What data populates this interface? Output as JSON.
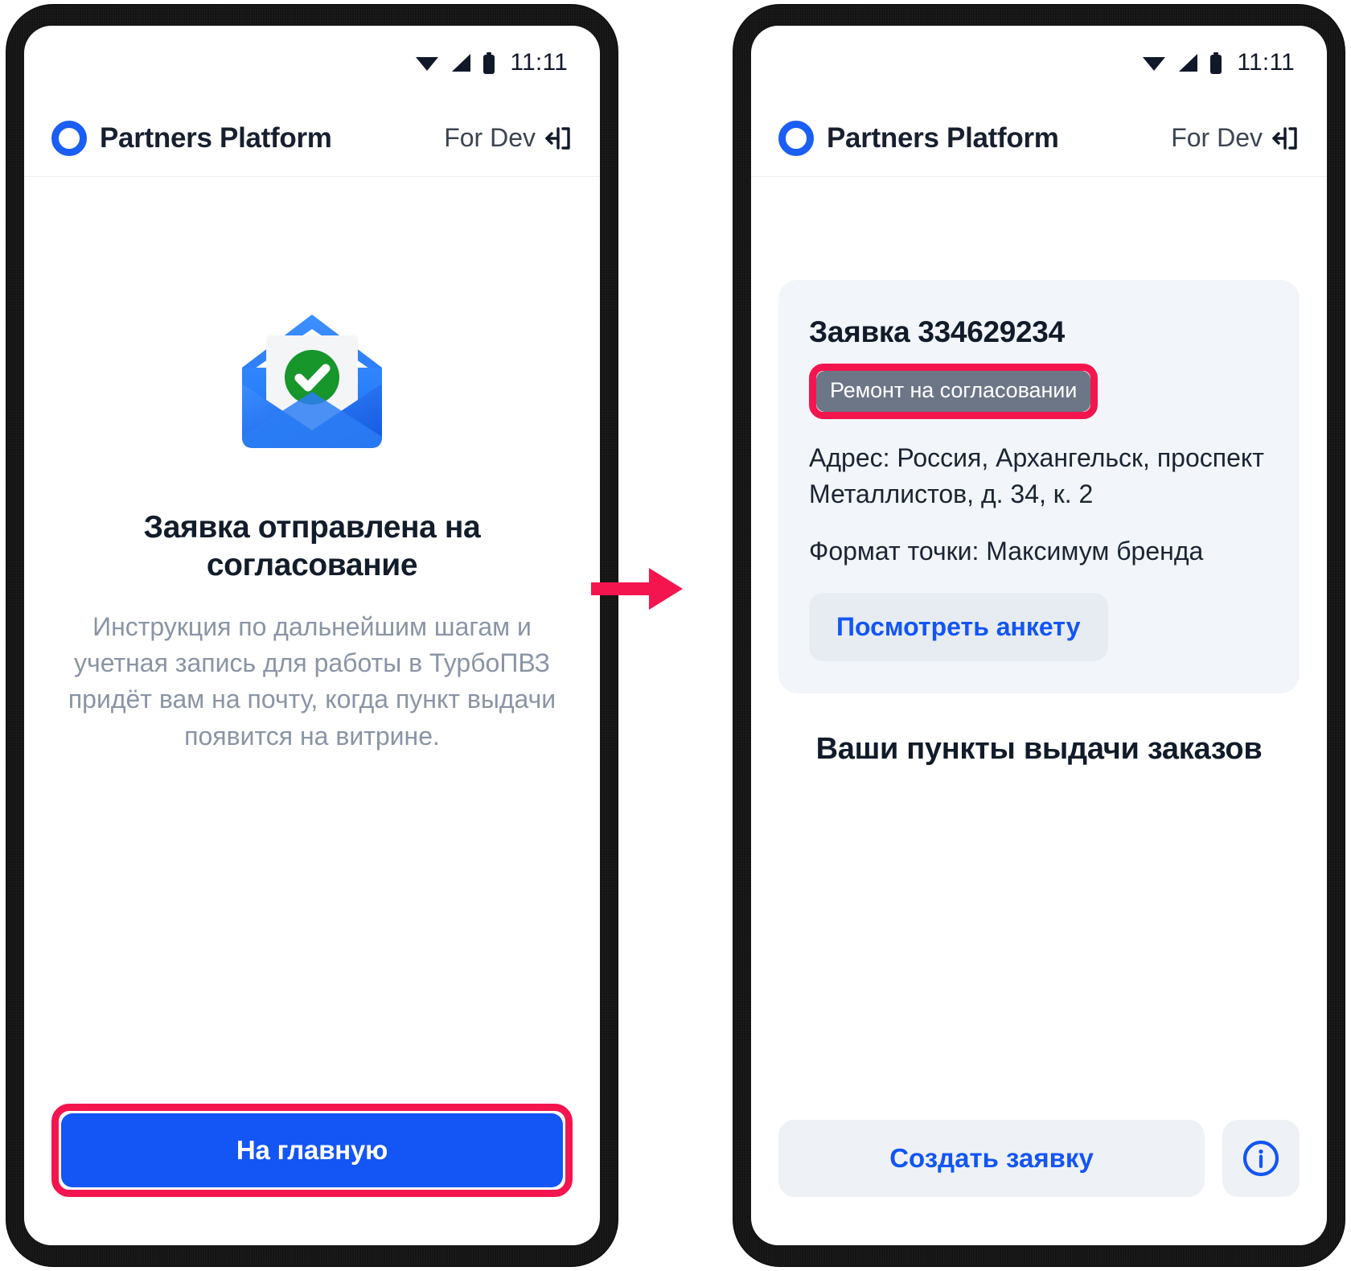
{
  "statusbar": {
    "time": "11:11",
    "icons": [
      "wifi-icon",
      "cellular-signal-icon",
      "battery-icon"
    ]
  },
  "appbar": {
    "brand_name": "Partners Platform",
    "env_label": "For Dev",
    "logo_icon": "partners-platform-logo-icon",
    "exit_icon": "exit-icon"
  },
  "left_screen": {
    "illustration_icon": "envelope-with-check-icon",
    "headline": "Заявка отправлена на согласование",
    "body": "Инструкция по дальнейшим шагам и учетная запись для работы в ТурбоПВЗ придёт вам на почту, когда пункт выдачи появится на витрине.",
    "primary_button": "На главную"
  },
  "right_screen": {
    "request_card": {
      "title": "Заявка 334629234",
      "status_badge": "Ремонт на согласовании",
      "address_line": "Адрес: Россия, Архангельск, проспект Металлистов, д. 34, к. 2",
      "format_line": "Формат точки: Максимум бренда",
      "view_form_button": "Посмотреть анкету"
    },
    "section_title": "Ваши пункты выдачи заказов",
    "create_button": "Создать заявку",
    "info_button_icon": "info-circle-icon"
  },
  "annotation": {
    "arrow_icon": "right-arrow-icon",
    "highlight_color": "#f4154f"
  },
  "colors": {
    "primary_blue": "#1355f5",
    "brand_blue": "#1a5ef5",
    "highlight_pink": "#f4154f",
    "badge_gray": "#6d7686",
    "card_bg": "#f2f5f9",
    "soft_button_bg": "#eef2f6",
    "muted_text": "#8a94a5",
    "dark_text": "#121b2a"
  }
}
